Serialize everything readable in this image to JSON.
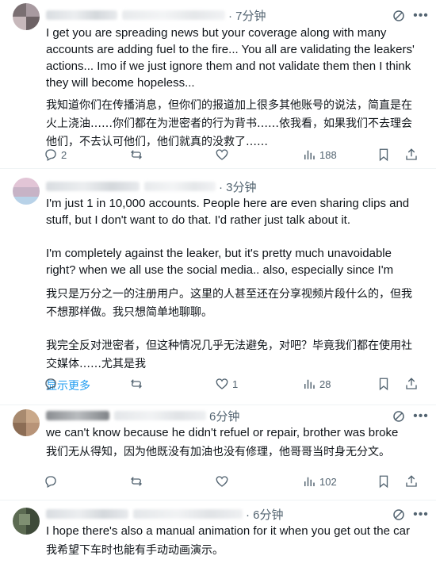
{
  "posts": [
    {
      "time": "· 7分钟",
      "en": "I get you are spreading news but your coverage along with many accounts are adding fuel to the fire... You all are validating the leakers' actions... Imo if we just ignore them and not validate them then I think they will become hopeless...",
      "zh": "我知道你们在传播消息，但你们的报道加上很多其他账号的说法，简直是在火上浇油……你们都在为泄密者的行为背书……依我看，如果我们不去理会他们，不去认可他们，他们就真的没救了……",
      "replies": "2",
      "reposts": "",
      "likes": "",
      "views": "188"
    },
    {
      "time": "· 3分钟",
      "en1": "I'm just 1 in 10,000 accounts. People here are even sharing clips and stuff, but I don't want to do that. I'd rather just talk about it.",
      "en2": "I'm completely against the leaker, but it's pretty much unavoidable right? when we all use the social media.. also, especially since I'm",
      "zh1": "我只是万分之一的注册用户。这里的人甚至还在分享视频片段什么的，但我不想那样做。我只想简单地聊聊。",
      "zh2": "我完全反对泄密者，但这种情况几乎无法避免，对吧？毕竟我们都在使用社交媒体……尤其是我",
      "show_more": "显示更多",
      "replies": "",
      "reposts": "",
      "likes": "1",
      "views": "28"
    },
    {
      "time": "6分钟",
      "en": "we can't know because he didn't refuel or repair, brother was broke",
      "zh": "我们无从得知，因为他既没有加油也没有修理，他哥哥当时身无分文。",
      "replies": "",
      "reposts": "",
      "likes": "",
      "views": "102"
    },
    {
      "time": "· 6分钟",
      "en": "I hope there's also a manual animation for it when you get out the car",
      "zh": "我希望下车时也能有手动动画演示。"
    }
  ],
  "icons": {
    "reply": "reply-icon",
    "repost": "repost-icon",
    "like": "heart-icon",
    "views": "views-icon",
    "grok": "grok-icon",
    "more": "more-icon"
  }
}
